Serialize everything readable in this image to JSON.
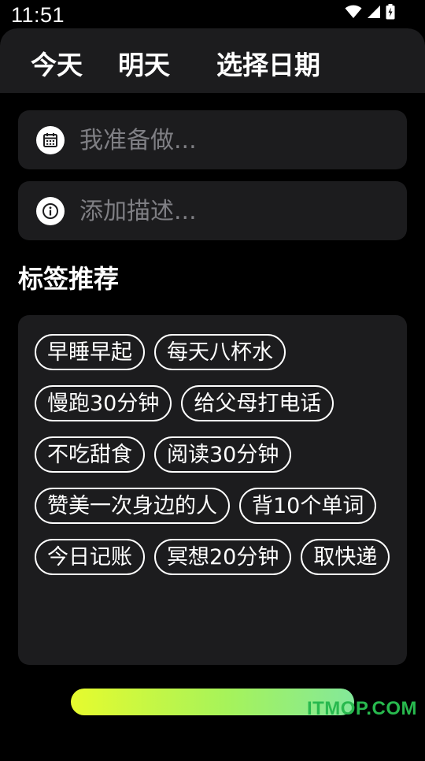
{
  "status_bar": {
    "time": "11:51",
    "icons": [
      "wifi-icon",
      "signal-icon",
      "battery-icon"
    ]
  },
  "date_tabs": [
    {
      "label": "今天"
    },
    {
      "label": "明天"
    },
    {
      "label": "选择日期"
    }
  ],
  "title_input": {
    "icon": "calendar-icon",
    "placeholder": "我准备做...",
    "value": ""
  },
  "description_input": {
    "icon": "info-icon",
    "placeholder": "添加描述...",
    "value": ""
  },
  "section_title": "标签推荐",
  "tags": [
    "早睡早起",
    "每天八杯水",
    "慢跑30分钟",
    "给父母打电话",
    "不吃甜食",
    "阅读30分钟",
    "赞美一次身边的人",
    "背10个单词",
    "今日记账",
    "冥想20分钟",
    "取快递"
  ],
  "submit_gradient": [
    "#e6fb2e",
    "#a6f35a",
    "#83e89a"
  ],
  "watermark": "ITMOP.COM",
  "colors": {
    "background": "#000000",
    "card": "#1c1c1e",
    "placeholder": "#7f7f84",
    "watermark": "#28b94e"
  }
}
